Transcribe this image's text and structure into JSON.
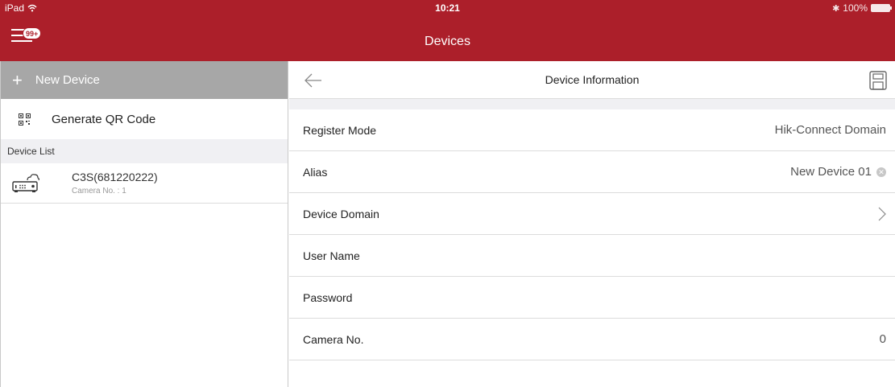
{
  "status_bar": {
    "device": "iPad",
    "time": "10:21",
    "battery": "100%"
  },
  "header": {
    "title": "Devices",
    "badge": "99+"
  },
  "sidebar": {
    "new_device": "New Device",
    "generate_qr": "Generate QR Code",
    "device_list_header": "Device List",
    "devices": [
      {
        "name": "C3S(681220222)",
        "sub": "Camera No. : 1"
      }
    ]
  },
  "detail": {
    "title": "Device Information",
    "rows": [
      {
        "label": "Register Mode",
        "value": "Hik-Connect Domain"
      },
      {
        "label": "Alias",
        "value": "New Device 01"
      },
      {
        "label": "Device Domain",
        "value": ""
      },
      {
        "label": "User Name",
        "value": ""
      },
      {
        "label": "Password",
        "value": ""
      },
      {
        "label": "Camera No.",
        "value": "0"
      }
    ]
  },
  "colors": {
    "brand": "#ac1f2a",
    "new_device_bg": "#a7a7a7",
    "section_bg": "#f0f0f3"
  },
  "icons": [
    "wifi-icon",
    "bluetooth-icon",
    "battery-icon",
    "menu-icon",
    "plus-icon",
    "qr-code-icon",
    "dvr-cloud-icon",
    "back-arrow-icon",
    "save-icon",
    "clear-icon",
    "chevron-right-icon"
  ]
}
